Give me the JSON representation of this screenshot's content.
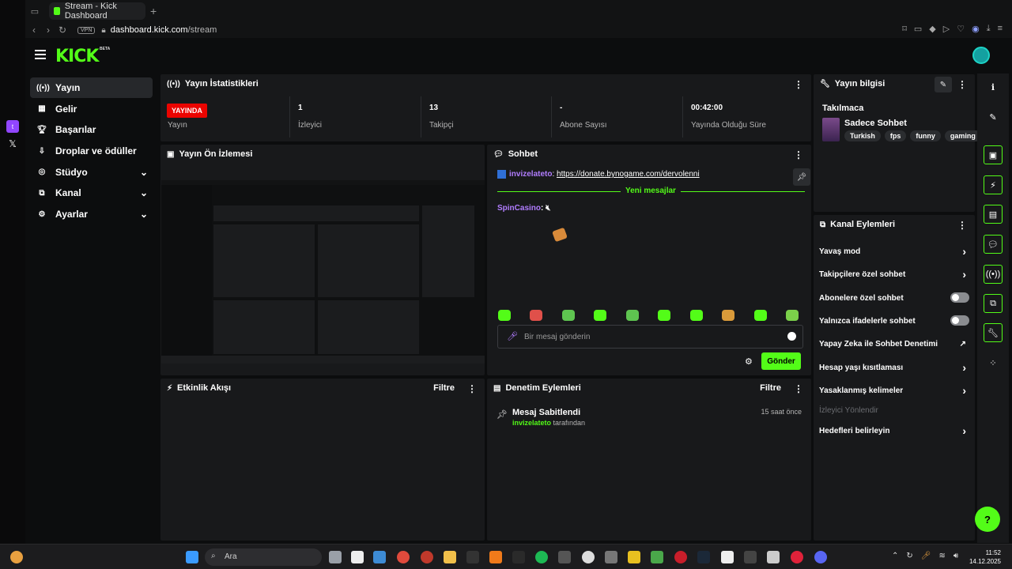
{
  "browser": {
    "tab_title": "Stream - Kick Dashboard",
    "vpn_label": "VPN",
    "url_domain": "dashboard.kick.com",
    "url_path": "/stream"
  },
  "header": {
    "logo": "KICK",
    "beta": "BETA"
  },
  "sidebar": {
    "items": [
      {
        "label": "Yayın"
      },
      {
        "label": "Gelir"
      },
      {
        "label": "Başarılar"
      },
      {
        "label": "Droplar ve ödüller"
      },
      {
        "label": "Stüdyo"
      },
      {
        "label": "Kanal"
      },
      {
        "label": "Ayarlar"
      }
    ]
  },
  "stats": {
    "title": "Yayın İstatistikleri",
    "live_badge": "YAYINDA",
    "status_label": "Yayın",
    "viewers_value": "1",
    "viewers_label": "İzleyici",
    "followers_value": "13",
    "followers_label": "Takipçi",
    "subs_value": "-",
    "subs_label": "Abone Sayısı",
    "duration_value": "00:42:00",
    "duration_label": "Yayında Olduğu Süre"
  },
  "preview": {
    "title": "Yayın Ön İzlemesi"
  },
  "chat": {
    "title": "Sohbet",
    "pinned_user": "invizelateto",
    "pinned_link": "https://donate.bynogame.com/dervolenni",
    "new_messages": "Yeni mesajlar",
    "msg_user": "SpinCasino",
    "placeholder": "Bir mesaj gönderin",
    "send": "Gönder"
  },
  "activity": {
    "title": "Etkinlik Akışı",
    "filter": "Filtre"
  },
  "moderation": {
    "title": "Denetim Eylemleri",
    "filter": "Filtre",
    "item_title": "Mesaj Sabitlendi",
    "item_time": "15 saat önce",
    "item_user": "invizelateto",
    "item_suffix": "tarafından"
  },
  "stream_info": {
    "title": "Yayın bilgisi",
    "stream_title": "Takılmaca",
    "category": "Sadece Sohbet",
    "tags": [
      "Turkish",
      "fps",
      "funny",
      "gaming"
    ]
  },
  "channel_actions": {
    "title": "Kanal Eylemleri",
    "items": [
      {
        "label": "Yavaş mod"
      },
      {
        "label": "Takipçilere özel sohbet"
      },
      {
        "label": "Abonelere özel sohbet"
      },
      {
        "label": "Yalnızca ifadelerle sohbet"
      },
      {
        "label": "Yapay Zeka ile Sohbet Denetimi"
      },
      {
        "label": "Hesap yaşı kısıtlaması"
      },
      {
        "label": "Yasaklanmış kelimeler"
      },
      {
        "label": "İzleyici Yönlendir"
      },
      {
        "label": "Hedefleri belirleyin"
      }
    ]
  },
  "taskbar": {
    "search": "Ara",
    "time": "11:52",
    "date": "14.12.2025"
  },
  "colors": {
    "accent": "#53fc18",
    "live": "#eb0400",
    "panel": "#18191b",
    "username": "#b17dff"
  }
}
